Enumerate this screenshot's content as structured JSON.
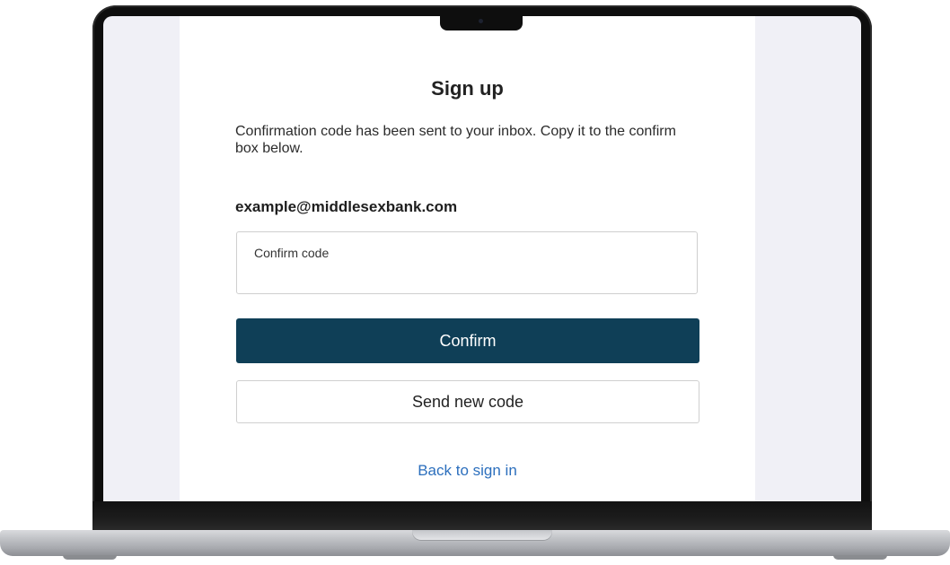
{
  "page": {
    "title": "Sign up",
    "description": "Confirmation code has been sent to your inbox. Copy it to the confirm box below.",
    "email": "example@middlesexbank.com"
  },
  "form": {
    "code_label": "Confirm code",
    "code_value": "",
    "confirm_label": "Confirm",
    "resend_label": "Send new code",
    "back_label": "Back to sign in"
  },
  "colors": {
    "primary": "#0f3f57",
    "link": "#2c6fbd",
    "screen_background": "#f0f0f6"
  }
}
